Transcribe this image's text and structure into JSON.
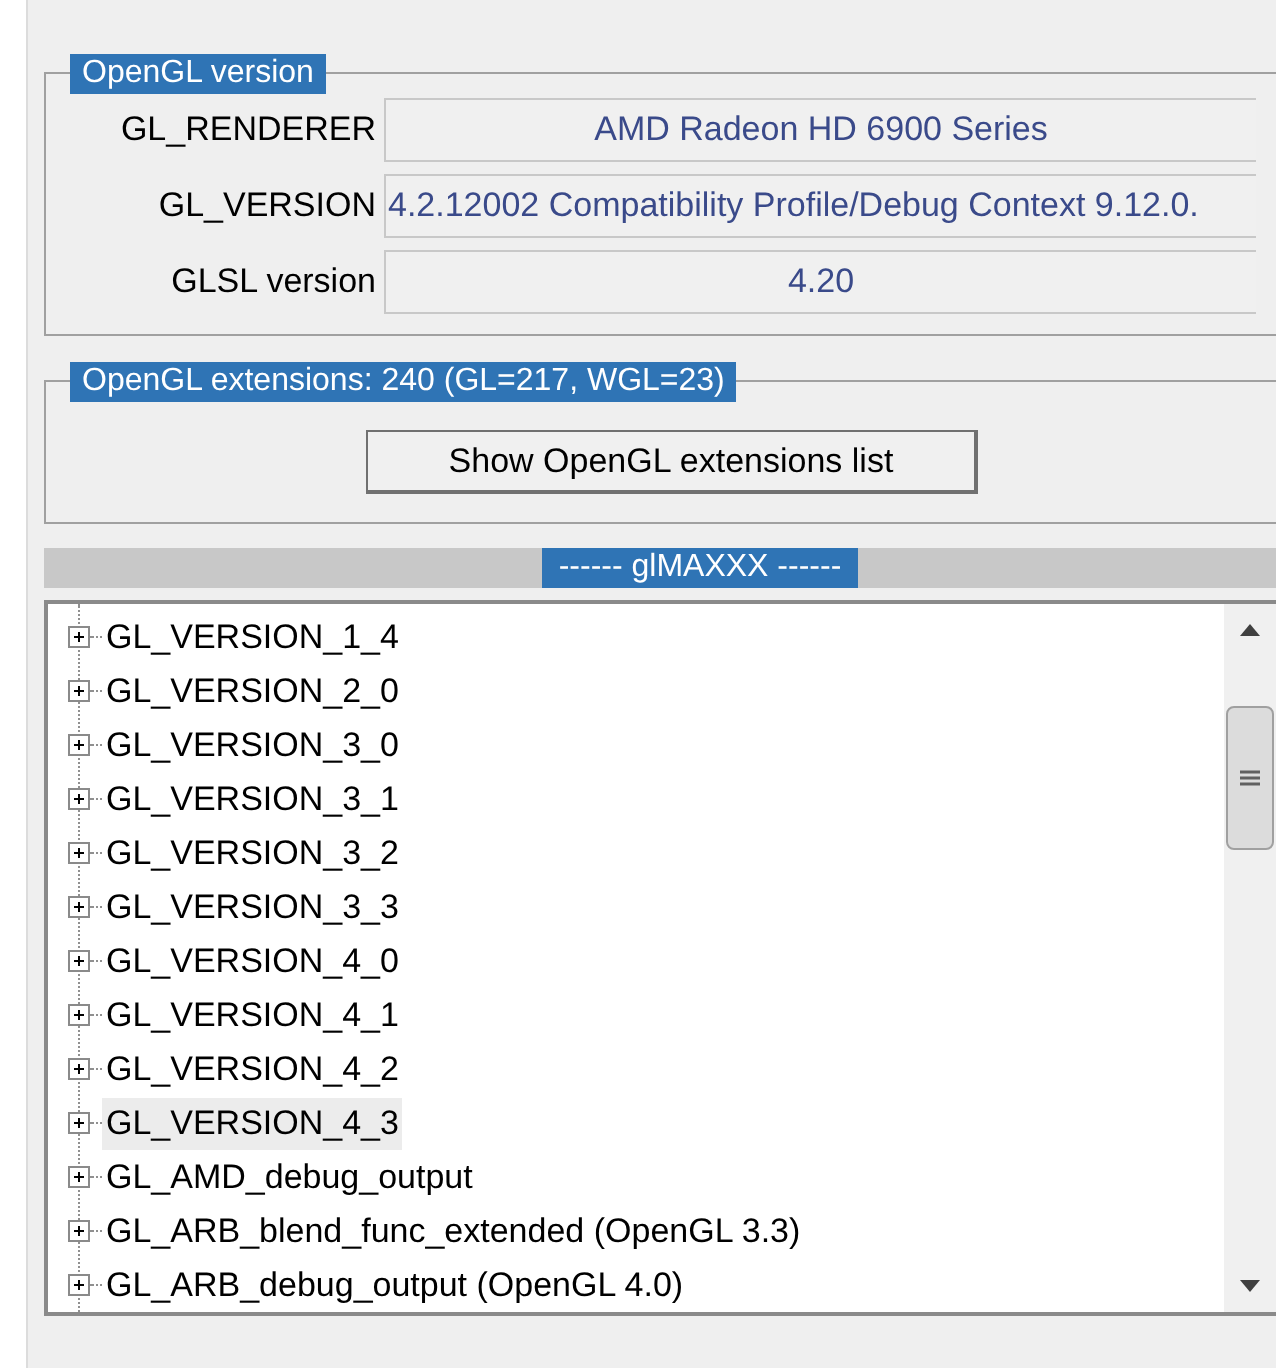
{
  "opengl_version": {
    "title": "OpenGL version",
    "fields": [
      {
        "label": "GL_RENDERER",
        "value": "AMD Radeon HD 6900 Series",
        "kind": "centered"
      },
      {
        "label": "GL_VERSION",
        "value": "4.2.12002 Compatibility Profile/Debug Context 9.12.0.",
        "kind": "overflowing"
      },
      {
        "label": "GLSL version",
        "value": "4.20",
        "kind": "centered"
      }
    ]
  },
  "extensions": {
    "title": "OpenGL extensions: 240 (GL=217, WGL=23)",
    "button": "Show OpenGL extensions list"
  },
  "tree": {
    "title": "------ glMAXXX ------",
    "items": [
      {
        "label": "GL_VERSION_1_4",
        "selected": false
      },
      {
        "label": "GL_VERSION_2_0",
        "selected": false
      },
      {
        "label": "GL_VERSION_3_0",
        "selected": false
      },
      {
        "label": "GL_VERSION_3_1",
        "selected": false
      },
      {
        "label": "GL_VERSION_3_2",
        "selected": false
      },
      {
        "label": "GL_VERSION_3_3",
        "selected": false
      },
      {
        "label": "GL_VERSION_4_0",
        "selected": false
      },
      {
        "label": "GL_VERSION_4_1",
        "selected": false
      },
      {
        "label": "GL_VERSION_4_2",
        "selected": false
      },
      {
        "label": "GL_VERSION_4_3",
        "selected": true
      },
      {
        "label": "GL_AMD_debug_output",
        "selected": false
      },
      {
        "label": "GL_ARB_blend_func_extended (OpenGL 3.3)",
        "selected": false
      },
      {
        "label": "GL_ARB_debug_output (OpenGL 4.0)",
        "selected": false
      }
    ]
  }
}
